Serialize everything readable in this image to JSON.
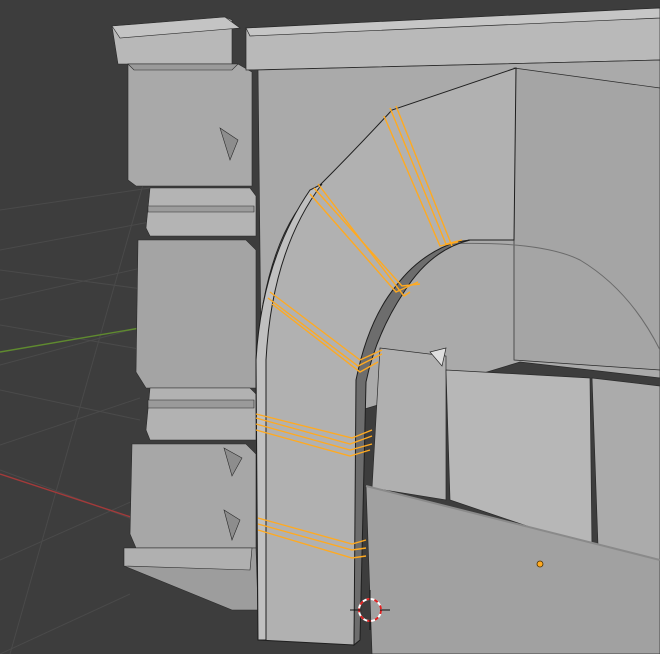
{
  "viewport": {
    "background_color": "#3d3d3d",
    "grid_line_color": "#4a4a4a",
    "x_axis_color": "#a33a3a",
    "y_axis_color": "#5f8a2f",
    "model_face_color": "#a9a9a9",
    "model_light_color": "#c2c2c2",
    "model_dark_color": "#8a8a8a",
    "edge_color": "#2a2a2a",
    "selection_color": "#ffaa21"
  },
  "overlays": {
    "cursor_icon": "3d-cursor-icon",
    "origin_icon": "object-origin-icon"
  }
}
